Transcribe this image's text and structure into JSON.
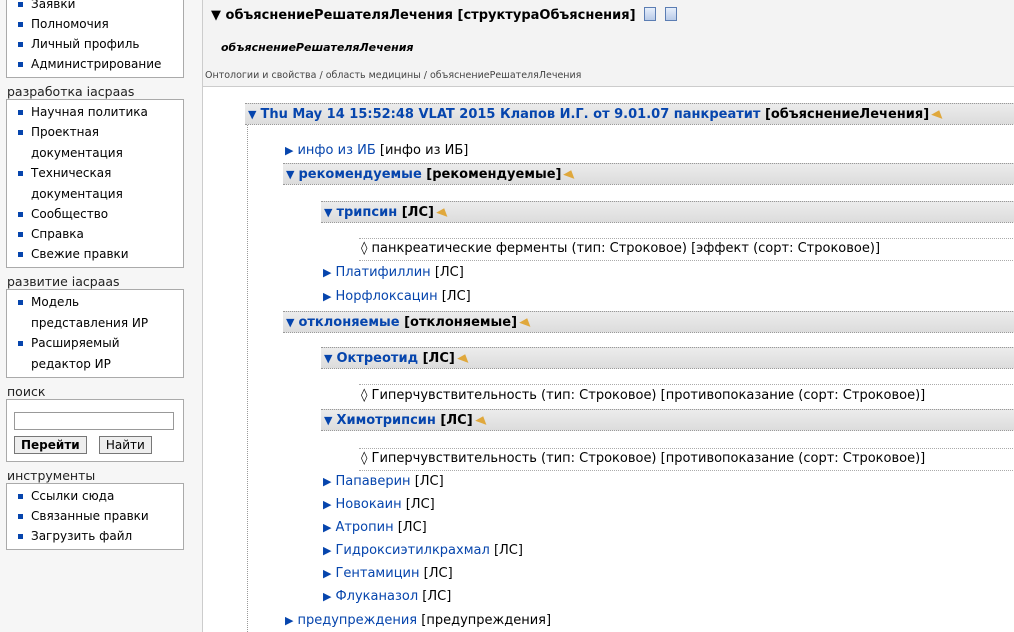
{
  "sidebar": {
    "top_items": [
      "Заявки",
      "Полномочия",
      "Личный профиль",
      "Администрирование"
    ],
    "dev_title": "разработка iacpaas",
    "dev_items": [
      "Научная политика",
      "Проектная документация",
      "Техническая документация",
      "Сообщество",
      "Справка",
      "Свежие правки"
    ],
    "evo_title": "развитие iacpaas",
    "evo_items": [
      "Модель представления ИР",
      "Расширяемый редактор ИР"
    ],
    "search_title": "поиск",
    "search_value": "",
    "go_label": "Перейти",
    "find_label": "Найти",
    "tools_title": "инструменты",
    "tools_items": [
      "Ссылки сюда",
      "Связанные правки",
      "Загрузить файл"
    ]
  },
  "header": {
    "title": "▼ объяснениеРешателяЛечения [структураОбъяснения]",
    "subtitle": "объяснениеРешателяЛечения",
    "breadcrumb": "Онтологии и свойства / область медицины / объяснениеРешателяЛечения"
  },
  "tree": {
    "root_name": "Thu May 14 15:52:48 VLAT 2015 Клапов И.Г. от 9.01.07 панкреатит",
    "root_type": "[объяснениеЛечения]",
    "info_name": "инфо из ИБ",
    "info_type": "[инфо из ИБ]",
    "rec_name": "рекомендуемые",
    "rec_type": "[рекомендуемые]",
    "tripsin_name": "трипсин",
    "tripsin_type": "[ЛС]",
    "tripsin_prop": "◊ панкреатические ферменты (тип: Строковое) [эффект (сорт: Строковое)]",
    "platifillin_name": "Платифиллин",
    "platifillin_type": "[ЛС]",
    "norflox_name": "Норфлоксацин",
    "norflox_type": "[ЛС]",
    "rej_name": "отклоняемые",
    "rej_type": "[отклоняемые]",
    "oktreotid_name": "Октреотид",
    "oktreotid_type": "[ЛС]",
    "oktreotid_prop": "◊ Гиперчувствительность (тип: Строковое) [противопоказание (сорт: Строковое)]",
    "himo_name": "Химотрипсин",
    "himo_type": "[ЛС]",
    "himo_prop": "◊ Гиперчувствительность (тип: Строковое) [противопоказание (сорт: Строковое)]",
    "rej_items": [
      {
        "name": "Папаверин",
        "type": "[ЛС]"
      },
      {
        "name": "Новокаин",
        "type": "[ЛС]"
      },
      {
        "name": "Атропин",
        "type": "[ЛС]"
      },
      {
        "name": "Гидроксиэтилкрахмал",
        "type": "[ЛС]"
      },
      {
        "name": "Гентамицин",
        "type": "[ЛС]"
      },
      {
        "name": "Флуканазол",
        "type": "[ЛС]"
      }
    ],
    "warn_name": "предупреждения",
    "warn_type": "[предупреждения]"
  }
}
